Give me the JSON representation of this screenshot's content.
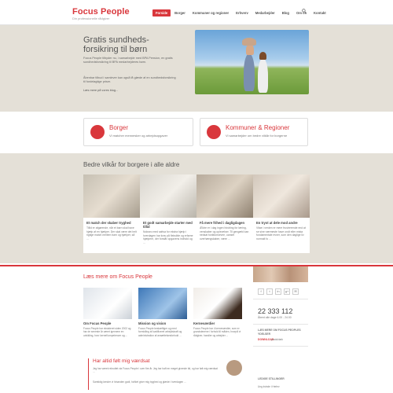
{
  "header": {
    "logo_title": "Focus People",
    "logo_sub": "Din professionelle rådgiver",
    "nav": [
      "Forside",
      "Borger",
      "Kommuner og regioner",
      "Erhverv",
      "Medarbejder",
      "Blog",
      "Om os",
      "Kontakt"
    ]
  },
  "hero": {
    "title": "Gratis sundheds-forsikring til børn",
    "p1": "Focus People tilbyder nu, i samarbejde med BPA Pension, en gratis sundhedsforsikring til BPA medarbejderes børn.",
    "p2": "Åbenbar tilbud i samlever kan også få glæde af en sundhedsforsikring til fordelagtige priser.",
    "link": "Læs mere på vores blog..."
  },
  "cta": [
    {
      "title": "Borger",
      "sub": "Vi matcher mennesker og arbejdsopgaver"
    },
    {
      "title": "Kommuner & Regioner",
      "sub": "Vi samarbejder om bedre vilkår for borgerne"
    }
  ],
  "section": {
    "title": "Bedre vilkår for borgere i alle aldre",
    "cards": [
      {
        "title": "Et match der skaber tryghed",
        "text": "Tillid er afgørende, når et barn skal have hjælp af en hjælper. Der skal være det helt rigtige match mellem barn og hjælper, så ..."
      },
      {
        "title": "Et godt samarbejde starter med tillid",
        "text": "Nokseo med sattva for ekstra hjælp i hverdagen har krav på fleksible og erfarne hjælpere, der forstår opgavens indhold og ..."
      },
      {
        "title": "Få mere frihed i dagligdagen",
        "text": "Ældre er i dag ingen hindring for læring, venskaber og oplevelser. Til gengæld kan nedsat funktionsevne, uanset overhængskaber, være ..."
      },
      {
        "title": "En tryst at dele mod andre",
        "text": "Vitae i verden er mere frustrerende end at se sine nærmeste have ondt eller mista fundamentale evner, som den daglige liv normalt fo ..."
      }
    ]
  },
  "lower": {
    "title": "Læs mere om Focus People",
    "cards": [
      {
        "title": "Om Focus People",
        "text": "Focus People har eksisteret siden 2002 og har de seneste år været igennem en udvikling, hvor kerneKompetencer og ..."
      },
      {
        "title": "Mission og vision",
        "text": "Focus People beskæftiger og med formidling af kvalificeret arbejdskraft og administration af ansættelsesforhold ..."
      },
      {
        "title": "Kerneværdier",
        "text": "Focus People har 4 kerneværdier, som er grundstenene i forhold til måden, hvorpå vi rådgiver, handler og arbejder ..."
      }
    ],
    "quote_title": "Har altid følt mig værdsat",
    "quote_p1": "Jeg har været rekruttet via Focus People i over fire år. Jeg har haft en meget givende tid, og har følt mig værdsat ...",
    "quote_p2": "Samtidig kender vi hinanden godt, hvilket giver mig tryghed og glæde i hverdagen ..."
  },
  "sidebar": {
    "social": [
      "f",
      "t",
      "in",
      "g+",
      "✉"
    ],
    "phone": "22 333 112",
    "hours": "Åbent alle dage 6.00 - 24.00",
    "head1": "LÆS MERE OM FOCUS PEOPLES YDELSER",
    "download_label": "DOWNLOAD",
    "download_text": "produktark",
    "head2": "LEDIGE STILLINGER",
    "job": "Ung kvinde i Herlev"
  },
  "colors": {
    "accent": "#d9373c",
    "stripe": "#e4e0d7"
  }
}
